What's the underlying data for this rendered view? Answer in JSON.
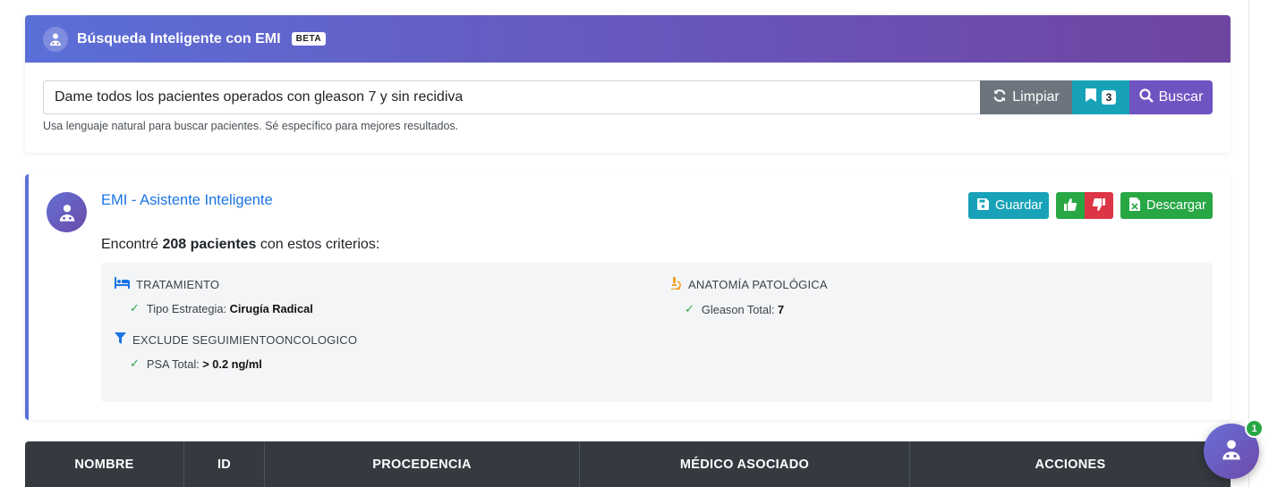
{
  "search": {
    "header_title": "Búsqueda Inteligente con EMI",
    "beta_label": "BETA",
    "query_value": "Dame todos los pacientes operados con gleason 7 y sin recidiva",
    "clear_label": "Limpiar",
    "saved_count": "3",
    "search_label": "Buscar",
    "help_text": "Usa lenguaje natural para buscar pacientes. Sé específico para mejores resultados."
  },
  "assistant": {
    "title": "EMI - Asistente Inteligente",
    "save_label": "Guardar",
    "download_label": "Descargar",
    "result_prefix": "Encontré ",
    "result_count": "208 pacientes",
    "result_suffix": " con estos criterios:",
    "criteria": [
      {
        "heading": "TRATAMIENTO",
        "icon": "bed-icon",
        "items": [
          {
            "label": "Tipo Estrategia: ",
            "value": "Cirugía Radical"
          }
        ]
      },
      {
        "heading": "ANATOMÍA PATOLÓGICA",
        "icon": "microscope-icon",
        "items": [
          {
            "label": "Gleason Total: ",
            "value": "7"
          }
        ]
      },
      {
        "heading": "EXCLUDE SEGUIMIENTOONCOLOGICO",
        "icon": "filter-icon",
        "items": [
          {
            "label": "PSA Total: ",
            "value": "> 0.2 ng/ml"
          }
        ]
      }
    ]
  },
  "table": {
    "columns": [
      "NOMBRE",
      "ID",
      "PROCEDENCIA",
      "MÉDICO ASOCIADO",
      "ACCIONES"
    ]
  },
  "fab": {
    "badge_count": "1"
  },
  "colors": {
    "header_gradient_start": "#5b6fd8",
    "header_gradient_end": "#6f45a1",
    "info": "#17a2b8",
    "success": "#28a745",
    "danger": "#dc3545",
    "secondary": "#6c757d",
    "link": "#1b74e4",
    "table_header": "#343a40"
  }
}
